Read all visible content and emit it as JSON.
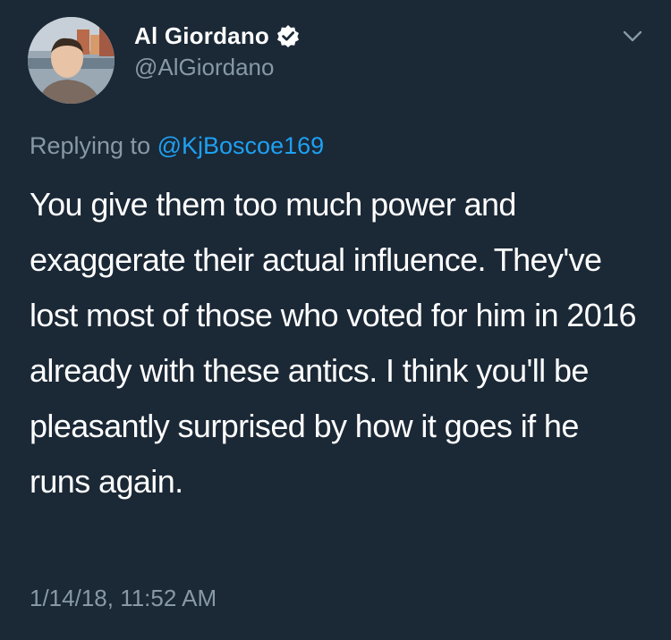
{
  "author": {
    "display_name": "Al Giordano",
    "handle": "@AlGiordano",
    "verified": true,
    "avatar_icon": "profile-photo"
  },
  "reply": {
    "prefix": "Replying to",
    "mention": "@KjBoscoe169"
  },
  "tweet": {
    "text": "You give them too much power and exaggerate their actual influence. They've lost most of those who voted for him in 2016 already with these antics. I think you'll be pleasantly surprised by how it goes if he runs again.",
    "timestamp": "1/14/18, 11:52 AM"
  },
  "menu": {
    "icon": "chevron-down-icon"
  },
  "colors": {
    "background": "#1b2836",
    "primary_text": "#ffffff",
    "secondary_text": "#8899a6",
    "accent": "#1da1f2"
  }
}
